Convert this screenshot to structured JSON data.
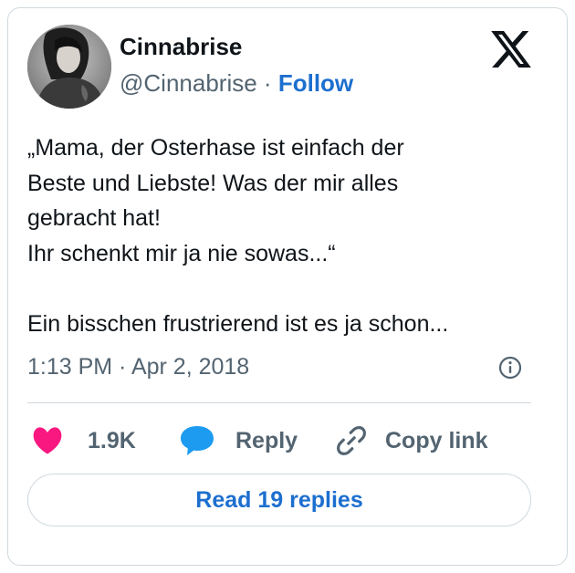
{
  "author": {
    "name": "Cinnabrise",
    "handle": "@Cinnabrise",
    "separator": "·",
    "follow_label": "Follow"
  },
  "tweet": {
    "text": "„Mama, der Osterhase ist einfach der\nBeste und Liebste! Was der mir alles\ngebracht hat!\nIhr schenkt mir ja nie sowas...“\n\nEin bisschen frustrierend ist es ja schon...",
    "timestamp": "1:13 PM · Apr 2, 2018"
  },
  "actions": {
    "like_count": "1.9K",
    "reply_label": "Reply",
    "copy_link_label": "Copy link"
  },
  "read_replies_label": "Read 19 replies",
  "icons": [
    "avatar",
    "x-logo-icon",
    "info-icon",
    "heart-icon",
    "reply-bubble-icon",
    "link-icon"
  ],
  "colors": {
    "accent": "#1d6fcf",
    "heart": "#f91880",
    "reply_icon": "#1d9bf0",
    "secondary_text": "#536471",
    "border": "#cfd9de"
  }
}
